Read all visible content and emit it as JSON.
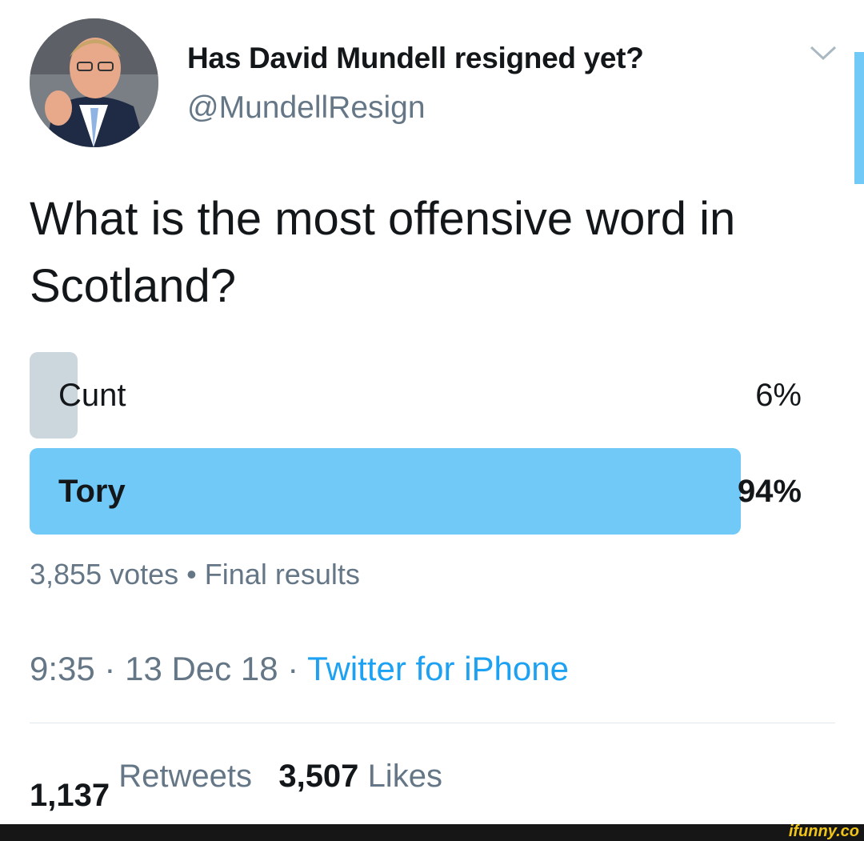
{
  "user": {
    "display_name": "Has David Mundell resigned yet?",
    "handle": "@MundellResign",
    "avatar_icon": "profile-photo"
  },
  "tweet": {
    "text": "What is the most offensive word in Scotland?"
  },
  "poll": {
    "options": [
      {
        "label": "Cunt",
        "percent_text": "6%",
        "percent": 6
      },
      {
        "label": "Tory",
        "percent_text": "94%",
        "percent": 94
      }
    ],
    "votes_text": "3,855 votes",
    "separator": "•",
    "status": "Final results"
  },
  "meta": {
    "time": "9:35",
    "dot1": "·",
    "date": "13 Dec 18",
    "dot2": "·",
    "source": "Twitter for iPhone"
  },
  "stats": {
    "retweets_count": "1,137",
    "retweets_label": "Retweets",
    "likes_count": "3,507",
    "likes_label": "Likes"
  },
  "watermark": "ifunny.co",
  "colors": {
    "accent": "#1da1f2",
    "winner_bar": "#71c9f8",
    "loser_bar": "#ccd6dd",
    "secondary_text": "#657786"
  }
}
